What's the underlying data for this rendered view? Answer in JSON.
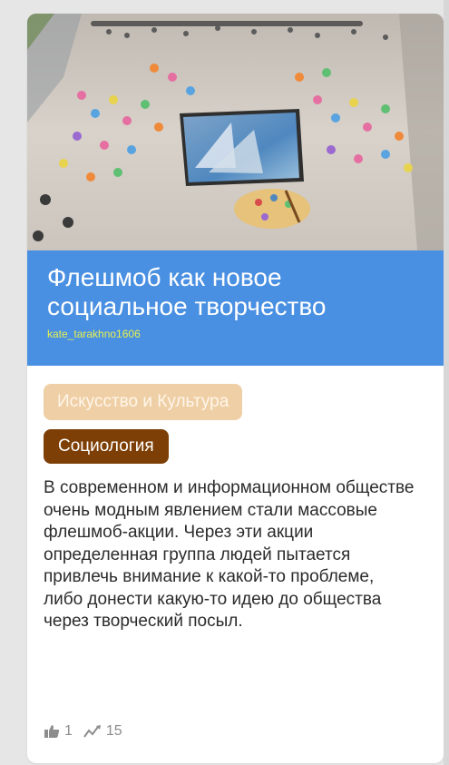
{
  "post": {
    "title": "Флешмоб как новое социальное творчество",
    "author": "kate_tarakhno1606",
    "tags": [
      {
        "label": "Искусство и Культура"
      },
      {
        "label": "Социология"
      }
    ],
    "description": "В современном и информационном обществе очень модным явлением стали массовые флешмоб-акции. Через эти акции определенная группа людей пытается привлечь внимание к какой-то проблеме, либо донести какую-то идею до общества через творческий посыл.",
    "stats": {
      "likes": "1",
      "views": "15"
    }
  },
  "icons": {
    "like": "thumbs-up-icon",
    "views": "trend-icon"
  },
  "colors": {
    "title_band": "#4a90e2",
    "author": "#e6f04f",
    "tag_light": "#efcfa6",
    "tag_dark": "#7d3f05"
  }
}
